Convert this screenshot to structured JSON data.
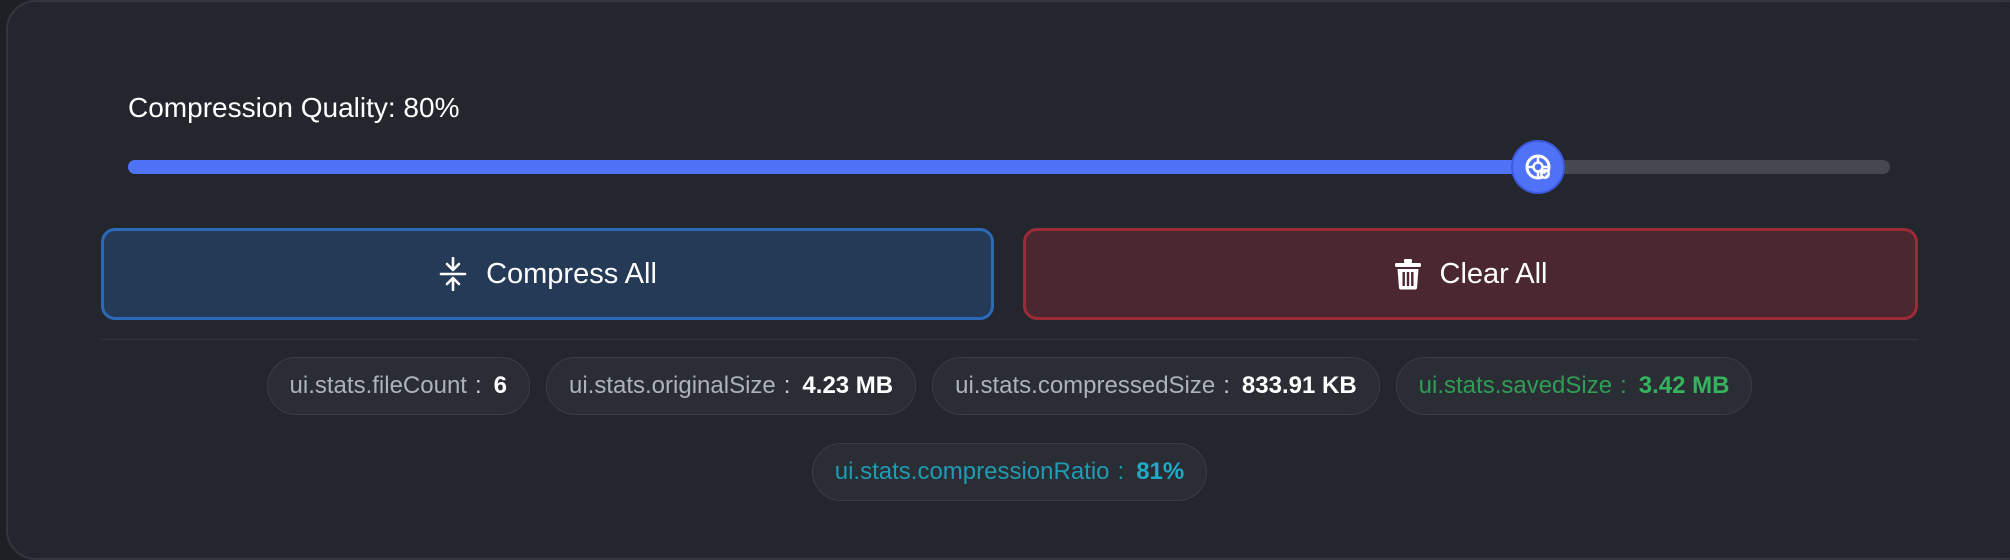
{
  "quality": {
    "label": "Compression Quality: 80%",
    "value": 80,
    "min": 0,
    "max": 100
  },
  "buttons": {
    "compress_label": "Compress All",
    "clear_label": "Clear All",
    "compress_icon": "compress-icon",
    "clear_icon": "trash-icon"
  },
  "stats": {
    "separator": ":",
    "items": [
      {
        "key": "ui.stats.fileCount",
        "value": "6",
        "tone": "default"
      },
      {
        "key": "ui.stats.originalSize",
        "value": "4.23 MB",
        "tone": "default"
      },
      {
        "key": "ui.stats.compressedSize",
        "value": "833.91 KB",
        "tone": "default"
      },
      {
        "key": "ui.stats.savedSize",
        "value": "3.42 MB",
        "tone": "green"
      },
      {
        "key": "ui.stats.compressionRatio",
        "value": "81%",
        "tone": "teal"
      }
    ]
  },
  "colors": {
    "accent": "#4f72f7",
    "compress_border": "#2d69b9",
    "clear_border": "#9c2b38",
    "saved_green": "#35b35e",
    "ratio_teal": "#22a9c4"
  }
}
